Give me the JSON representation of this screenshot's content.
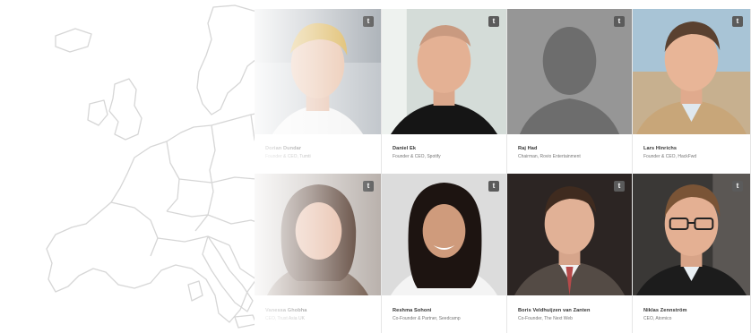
{
  "profiles": [
    {
      "name": "Dorian Dundar",
      "role": "Founder & CEO, Tumti",
      "photo": "blond-man-white-tshirt"
    },
    {
      "name": "Daniel Ek",
      "role": "Founder & CEO, Spotify",
      "photo": "bald-man-black-shirt"
    },
    {
      "name": "Raj Had",
      "role": "Chairman, Rovio Entertainment",
      "photo": "silhouette-placeholder"
    },
    {
      "name": "Lars Hinrichs",
      "role": "Founder & CEO, HackFwd",
      "photo": "man-beige-jacket"
    },
    {
      "name": "Vanessa Ghobha",
      "role": "CEO, Trust Asia UK",
      "photo": "woman-brown-hair"
    },
    {
      "name": "Reshma Sohoni",
      "role": "Co-Founder & Partner, Seedcamp",
      "photo": "woman-black-hair-smiling"
    },
    {
      "name": "Boris Veldhuijzen van Zanten",
      "role": "Co-Founder, The Next Web",
      "photo": "man-suit-tie"
    },
    {
      "name": "Niklas Zennström",
      "role": "CEO, Atomico",
      "photo": "man-glasses"
    }
  ],
  "badge_icon": "twitter-icon",
  "colors": {
    "map_stroke": "#d8d8d8",
    "photo_bg_light": "#c9c9c9",
    "photo_bg_dark": "#5a5a5a",
    "silhouette": "#7a7a7a",
    "caption_name": "#333333",
    "caption_role": "#777777"
  }
}
